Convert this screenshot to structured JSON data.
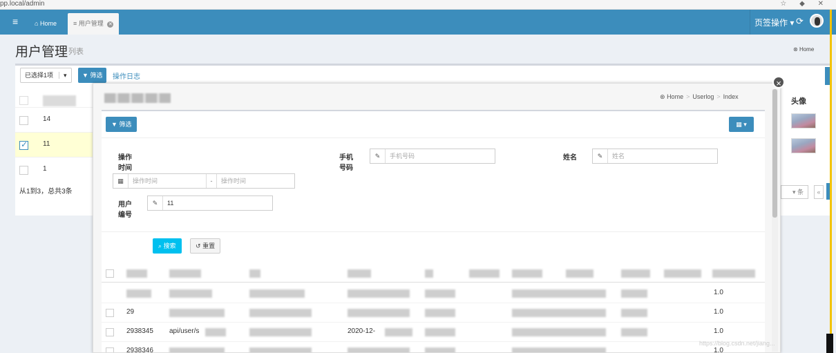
{
  "browser": {
    "url": "pp.local/admin"
  },
  "nav": {
    "home_tab": "Home",
    "active_tab": "用户管理",
    "page_ops": "页签操作",
    "caret": "▾"
  },
  "header": {
    "title": "用户管理",
    "subtitle": "列表",
    "breadcrumb": "Home"
  },
  "toolbar": {
    "selected": "已选择1项",
    "filter": "筛选",
    "log_link": "操作日志"
  },
  "bg_table": {
    "rows": [
      {
        "id": "14"
      },
      {
        "id": "11"
      },
      {
        "id": "1"
      }
    ],
    "range_text": "从1到3，总共3条",
    "avatar_header": "头像",
    "per_page_suffix": "条"
  },
  "modal": {
    "breadcrumb": [
      "Home",
      "Userlog",
      "Index"
    ],
    "filter": "筛选",
    "grid_icon": "▦ ▾",
    "fields": {
      "op_time_label": "操作时间",
      "op_time_start_ph": "操作时间",
      "op_time_end_ph": "操作时间",
      "range_sep": "-",
      "phone_label": "手机号码",
      "phone_ph": "手机号码",
      "name_label": "姓名",
      "name_ph": "姓名",
      "user_id_label": "用户编号",
      "user_id_value": "11"
    },
    "search": "搜索",
    "reset": "重置",
    "rows": [
      {
        "id": "",
        "api": "",
        "date": "",
        "ver": "1.0"
      },
      {
        "id": "29",
        "api": "",
        "date": "",
        "ver": "1.0"
      },
      {
        "id": "2938345",
        "api": "api/user/s",
        "date": "2020-12-",
        "ver": "1.0"
      },
      {
        "id": "2938346",
        "api": "",
        "date": "",
        "ver": "1.0"
      }
    ]
  },
  "watermark": "https://blog.csdn.net/jiang..."
}
